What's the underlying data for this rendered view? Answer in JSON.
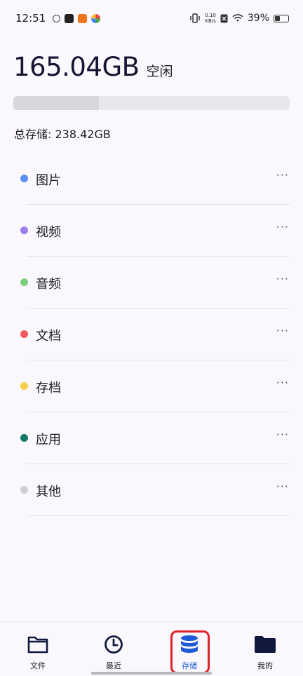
{
  "status_bar": {
    "time": "12:51",
    "net_speed_value": "0.10",
    "net_speed_unit": "KB/s",
    "battery_percent": "39%",
    "battery_level": 0.39
  },
  "storage": {
    "free_value": "165.04GB",
    "free_label": "空闲",
    "total_text": "总存储: 238.42GB",
    "used_fraction": 0.31
  },
  "categories": [
    {
      "label": "图片",
      "color": "#5b8ff0"
    },
    {
      "label": "视频",
      "color": "#9d7cf0"
    },
    {
      "label": "音频",
      "color": "#7ccf7c"
    },
    {
      "label": "文档",
      "color": "#ec5c5c"
    },
    {
      "label": "存档",
      "color": "#f5cf4a"
    },
    {
      "label": "应用",
      "color": "#0f7a68"
    },
    {
      "label": "其他",
      "color": "#cfcfcf"
    }
  ],
  "more_glyph": "···",
  "bottom_nav": {
    "files": "文件",
    "recent": "最近",
    "storage": "存储",
    "mine": "我的"
  },
  "colors": {
    "accent": "#1d5bd6",
    "highlight": "#e0202b",
    "dark_icon": "#10183d"
  }
}
